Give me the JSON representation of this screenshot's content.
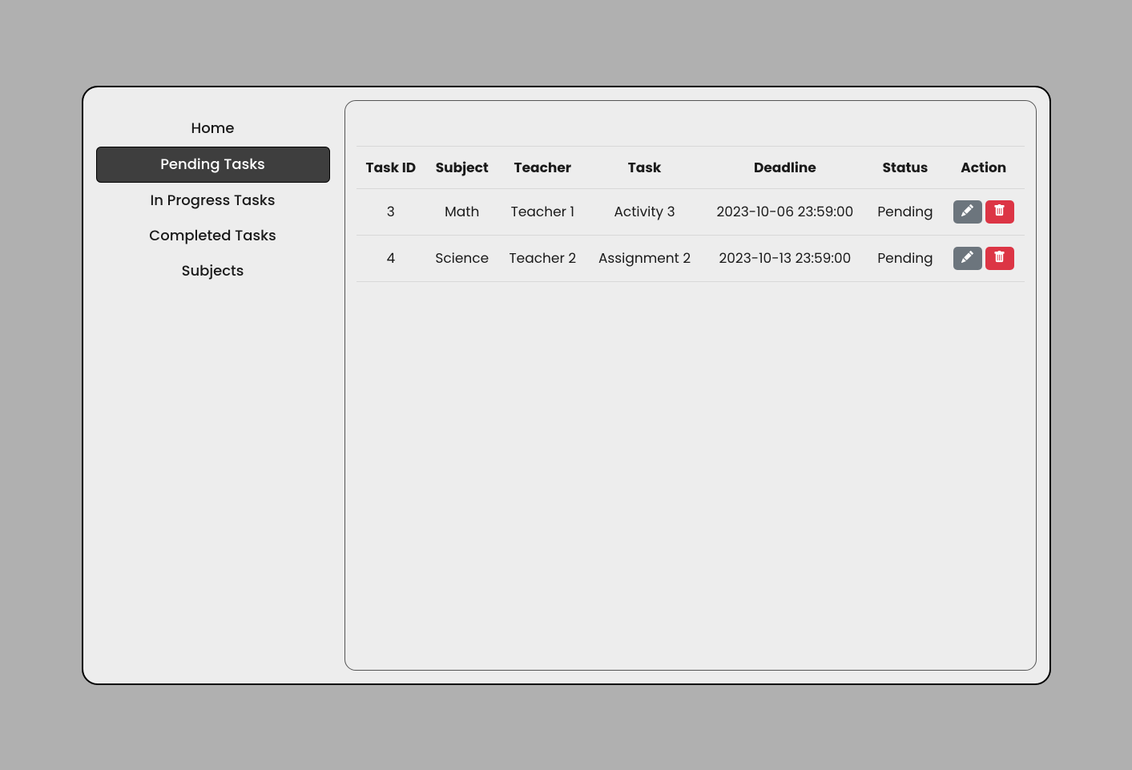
{
  "sidebar": {
    "items": [
      {
        "label": "Home",
        "active": false
      },
      {
        "label": "Pending Tasks",
        "active": true
      },
      {
        "label": "In Progress Tasks",
        "active": false
      },
      {
        "label": "Completed Tasks",
        "active": false
      },
      {
        "label": "Subjects",
        "active": false
      }
    ]
  },
  "table": {
    "headers": [
      "Task ID",
      "Subject",
      "Teacher",
      "Task",
      "Deadline",
      "Status",
      "Action"
    ],
    "rows": [
      {
        "task_id": "3",
        "subject": "Math",
        "teacher": "Teacher 1",
        "task": "Activity 3",
        "deadline": "2023-10-06 23:59:00",
        "status": "Pending"
      },
      {
        "task_id": "4",
        "subject": "Science",
        "teacher": "Teacher 2",
        "task": "Assignment 2",
        "deadline": "2023-10-13 23:59:00",
        "status": "Pending"
      }
    ]
  }
}
